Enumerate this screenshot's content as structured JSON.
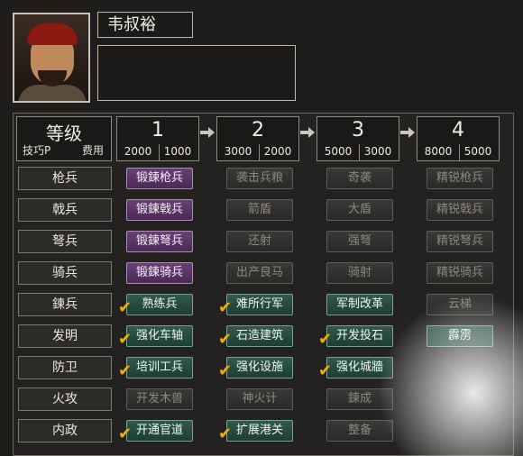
{
  "character": {
    "name": "韦叔裕",
    "portrait_icon": "general-portrait"
  },
  "header": {
    "title": "等级",
    "left_sub": "技巧P",
    "right_sub": "费用"
  },
  "levels": [
    {
      "num": "1",
      "skill": "2000",
      "cost": "1000"
    },
    {
      "num": "2",
      "skill": "3000",
      "cost": "2000"
    },
    {
      "num": "3",
      "skill": "5000",
      "cost": "3000"
    },
    {
      "num": "4",
      "skill": "8000",
      "cost": "5000"
    }
  ],
  "rows": [
    {
      "label": "枪兵",
      "cells": [
        {
          "text": "锻鍊枪兵",
          "style": "pur",
          "check": false
        },
        {
          "text": "袭击兵粮",
          "style": "gry",
          "check": false
        },
        {
          "text": "奇袭",
          "style": "gry",
          "check": false
        },
        {
          "text": "精锐枪兵",
          "style": "gry",
          "check": false
        }
      ]
    },
    {
      "label": "戟兵",
      "cells": [
        {
          "text": "锻鍊戟兵",
          "style": "pur",
          "check": false
        },
        {
          "text": "箭盾",
          "style": "gry",
          "check": false
        },
        {
          "text": "大盾",
          "style": "gry",
          "check": false
        },
        {
          "text": "精锐戟兵",
          "style": "gry",
          "check": false
        }
      ]
    },
    {
      "label": "弩兵",
      "cells": [
        {
          "text": "锻鍊弩兵",
          "style": "pur",
          "check": false
        },
        {
          "text": "还射",
          "style": "gry",
          "check": false
        },
        {
          "text": "强弩",
          "style": "gry",
          "check": false
        },
        {
          "text": "精锐弩兵",
          "style": "gry",
          "check": false
        }
      ]
    },
    {
      "label": "骑兵",
      "cells": [
        {
          "text": "锻鍊骑兵",
          "style": "pur",
          "check": false
        },
        {
          "text": "出产良马",
          "style": "gry",
          "check": false
        },
        {
          "text": "骑射",
          "style": "gry",
          "check": false
        },
        {
          "text": "精锐骑兵",
          "style": "gry",
          "check": false
        }
      ]
    },
    {
      "label": "鍊兵",
      "cells": [
        {
          "text": "熟练兵",
          "style": "grn",
          "check": true
        },
        {
          "text": "难所行军",
          "style": "grn",
          "check": true
        },
        {
          "text": "军制改革",
          "style": "grn",
          "check": false
        },
        {
          "text": "云梯",
          "style": "gry",
          "check": false
        }
      ]
    },
    {
      "label": "发明",
      "cells": [
        {
          "text": "强化车轴",
          "style": "grn",
          "check": true
        },
        {
          "text": "石造建筑",
          "style": "grn",
          "check": true
        },
        {
          "text": "开发投石",
          "style": "grn",
          "check": true
        },
        {
          "text": "霹雳",
          "style": "grn",
          "check": false
        }
      ]
    },
    {
      "label": "防卫",
      "cells": [
        {
          "text": "培训工兵",
          "style": "grn",
          "check": true
        },
        {
          "text": "强化设施",
          "style": "grn",
          "check": true
        },
        {
          "text": "强化城牆",
          "style": "grn",
          "check": true
        },
        {
          "text": "",
          "style": "none",
          "check": false
        }
      ]
    },
    {
      "label": "火攻",
      "cells": [
        {
          "text": "开发木兽",
          "style": "gry",
          "check": false
        },
        {
          "text": "神火计",
          "style": "gry",
          "check": false
        },
        {
          "text": "鍊成",
          "style": "gry",
          "check": false
        },
        {
          "text": "",
          "style": "none",
          "check": false
        }
      ]
    },
    {
      "label": "内政",
      "cells": [
        {
          "text": "开通官道",
          "style": "grn",
          "check": true
        },
        {
          "text": "扩展港关",
          "style": "grn",
          "check": true
        },
        {
          "text": "整备",
          "style": "gry",
          "check": false
        },
        {
          "text": "",
          "style": "none",
          "check": false
        }
      ]
    }
  ]
}
